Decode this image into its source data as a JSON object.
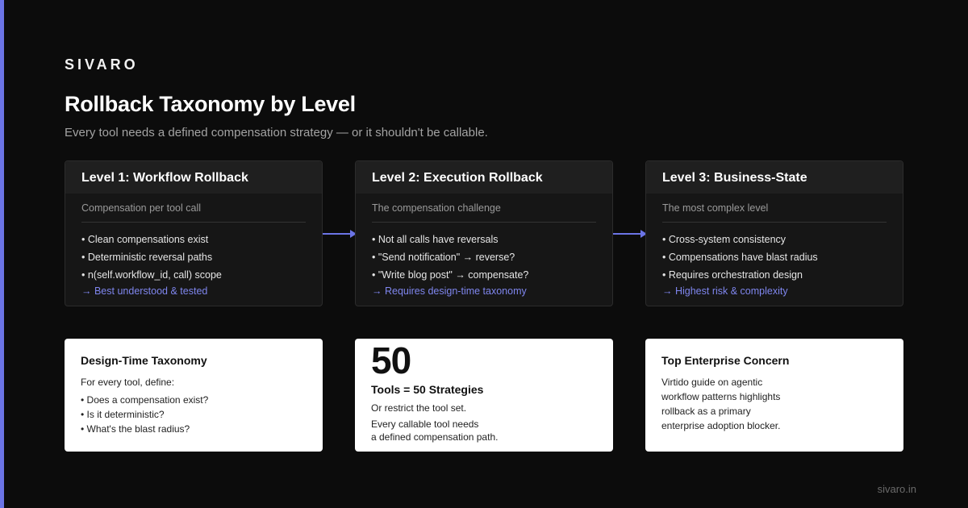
{
  "brand": "SIVARO",
  "title": "Rollback Taxonomy by Level",
  "subtitle": "Every tool needs a defined compensation strategy — or it shouldn't be callable.",
  "colors": {
    "accent": "#6b74e6",
    "background": "#0c0c0c",
    "card": "#161616",
    "link": "#7f86ee"
  },
  "levels": [
    {
      "title": "Level 1: Workflow Rollback",
      "caption": "Compensation per tool call",
      "bullets": [
        "• Clean compensations exist",
        "• Deterministic reversal paths",
        "• n(self.workflow_id, call) scope"
      ],
      "highlight": "→ Best understood & tested"
    },
    {
      "title": "Level 2: Execution Rollback",
      "caption": "The compensation challenge",
      "bullets": [
        "• Not all calls have reversals",
        "• \"Send notification\" → reverse?",
        "• \"Write blog post\" → compensate?"
      ],
      "highlight": "→ Requires design-time taxonomy"
    },
    {
      "title": "Level 3: Business-State",
      "caption": "The most complex level",
      "bullets": [
        "• Cross-system consistency",
        "• Compensations have blast radius",
        "• Requires orchestration design"
      ],
      "highlight": "→ Highest risk & complexity"
    }
  ],
  "design_card": {
    "title": "Design-Time Taxonomy",
    "intro": "For every tool, define:",
    "items": [
      "• Does a compensation exist?",
      "• Is it deterministic?",
      "• What's the blast radius?"
    ]
  },
  "stat_card": {
    "number": "50",
    "title": "Tools = 50 Strategies",
    "line1": "Or restrict the tool set.",
    "line2": "Every callable tool needs",
    "line3": "a defined compensation path."
  },
  "concern_card": {
    "title": "Top Enterprise Concern",
    "lines": [
      "Virtido guide on agentic",
      "workflow patterns highlights",
      "rollback as a primary",
      "enterprise adoption blocker."
    ]
  },
  "footer": "sivaro.in"
}
